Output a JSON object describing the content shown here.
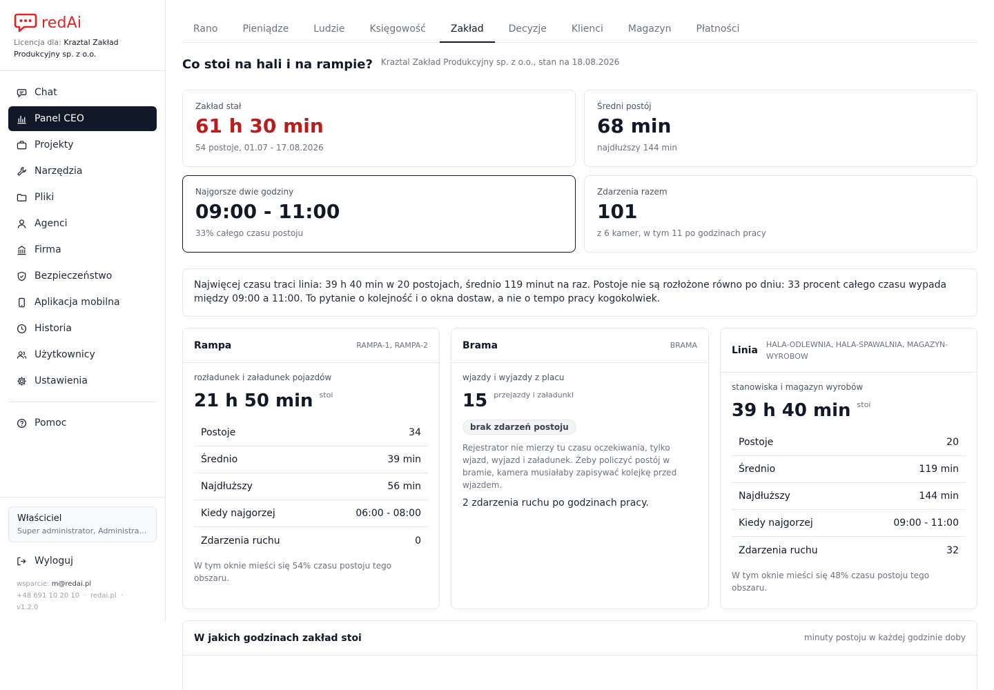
{
  "brand": {
    "name": "redAi",
    "color": "#dc2626"
  },
  "license": {
    "prefix": "Licencja dla:",
    "company": "Kraztal Zakład Produkcyjny sp. z o.o."
  },
  "nav": {
    "items": [
      {
        "label": "Chat",
        "icon": "chat-icon"
      },
      {
        "label": "Panel CEO",
        "icon": "bar-chart-icon",
        "active": true
      },
      {
        "label": "Projekty",
        "icon": "briefcase-icon"
      },
      {
        "label": "Narzędzia",
        "icon": "wrench-icon"
      },
      {
        "label": "Pliki",
        "icon": "folder-icon"
      },
      {
        "label": "Agenci",
        "icon": "user-icon"
      },
      {
        "label": "Firma",
        "icon": "building-icon"
      },
      {
        "label": "Bezpieczeństwo",
        "icon": "shield-icon"
      },
      {
        "label": "Aplikacja mobilna",
        "icon": "smartphone-icon"
      },
      {
        "label": "Historia",
        "icon": "clock-icon"
      },
      {
        "label": "Użytkownicy",
        "icon": "users-icon"
      },
      {
        "label": "Ustawienia",
        "icon": "gear-icon"
      }
    ],
    "help": {
      "label": "Pomoc",
      "icon": "help-circle-icon"
    }
  },
  "user": {
    "name": "Właściciel",
    "role": "Super administrator, Administrator"
  },
  "logout": {
    "label": "Wyloguj",
    "icon": "logout-icon"
  },
  "support": {
    "prefix": "wsparcie:",
    "email": "m@redai.pl",
    "phone": "+48 691 10 20 10",
    "separator": "·",
    "site": "redai.pl",
    "version": "v1.2.0"
  },
  "tabs": [
    {
      "label": "Rano"
    },
    {
      "label": "Pieniądze"
    },
    {
      "label": "Ludzie"
    },
    {
      "label": "Księgowość"
    },
    {
      "label": "Zakład",
      "active": true
    },
    {
      "label": "Decyzje"
    },
    {
      "label": "Klienci"
    },
    {
      "label": "Magazyn"
    },
    {
      "label": "Płatności"
    }
  ],
  "page": {
    "title": "Co stoi na hali i na rampie?",
    "subtitle": "Kraztal Zakład Produkcyjny sp. z o.o., stan na 18.08.2026"
  },
  "kpis": {
    "downtime": {
      "label": "Zakład stał",
      "value": "61 h 30 min",
      "note": "54 postoje, 01.07 - 17.08.2026"
    },
    "avg": {
      "label": "Średni postój",
      "value": "68 min",
      "note": "najdłuższy 144 min"
    },
    "worst": {
      "label": "Najgorsze dwie godziny",
      "value": "09:00 - 11:00",
      "note": "33% całego czasu postoju"
    },
    "events": {
      "label": "Zdarzenia razem",
      "value": "101",
      "note": "z 6 kamer, w tym 11 po godzinach pracy"
    }
  },
  "summary": "Najwięcej czasu traci linia: 39 h 40 min w 20 postojach, średnio 119 minut na raz. Postoje nie są rozłożone równo po dniu: 33 procent całego czasu wypada między 09:00 a 11:00. To pytanie o kolejność i o okna dostaw, a nie o tempo pracy kogokolwiek.",
  "zones": {
    "rampa": {
      "title": "Rampa",
      "tags": "RAMPA-1, RAMPA-2",
      "desc": "rozładunek i załadunek pojazdów",
      "value": "21 h 50 min",
      "unit": "stoi",
      "stats": [
        {
          "label": "Postoje",
          "value": "34"
        },
        {
          "label": "Średnio",
          "value": "39 min"
        },
        {
          "label": "Najdłuższy",
          "value": "56 min"
        },
        {
          "label": "Kiedy najgorzej",
          "value": "06:00 - 08:00"
        },
        {
          "label": "Zdarzenia ruchu",
          "value": "0"
        }
      ],
      "foot": "W tym oknie mieści się 54% czasu postoju tego obszaru."
    },
    "brama": {
      "title": "Brama",
      "tags": "BRAMA",
      "desc": "wjazdy i wyjazdy z placu",
      "value": "15",
      "unit": "przejazdy i załadunki",
      "badge": "brak zdarzeń postoju",
      "para": "Rejestrator nie mierzy tu czasu oczekiwania, tylko wjazd, wyjazd i załadunek. Żeby policzyć postój w bramie, kamera musiałaby zapisywać kolejkę przed wjazdem.",
      "line": "2 zdarzenia ruchu po godzinach pracy."
    },
    "linia": {
      "title": "Linia",
      "tags": "HALA-ODLEWNIA, HALA-SPAWALNIA, MAGAZYN-WYROBOW",
      "desc": "stanowiska i magazyn wyrobów",
      "value": "39 h 40 min",
      "unit": "stoi",
      "stats": [
        {
          "label": "Postoje",
          "value": "20"
        },
        {
          "label": "Średnio",
          "value": "119 min"
        },
        {
          "label": "Najdłuższy",
          "value": "144 min"
        },
        {
          "label": "Kiedy najgorzej",
          "value": "09:00 - 11:00"
        },
        {
          "label": "Zdarzenia ruchu",
          "value": "32"
        }
      ],
      "foot": "W tym oknie mieści się 48% czasu postoju tego obszaru."
    }
  },
  "hours_panel": {
    "title": "W jakich godzinach zakład stoi",
    "note": "minuty postoju w każdej godzinie doby"
  },
  "colors": {
    "accent_dark": "#111827",
    "alert_red": "#b91c1c"
  }
}
